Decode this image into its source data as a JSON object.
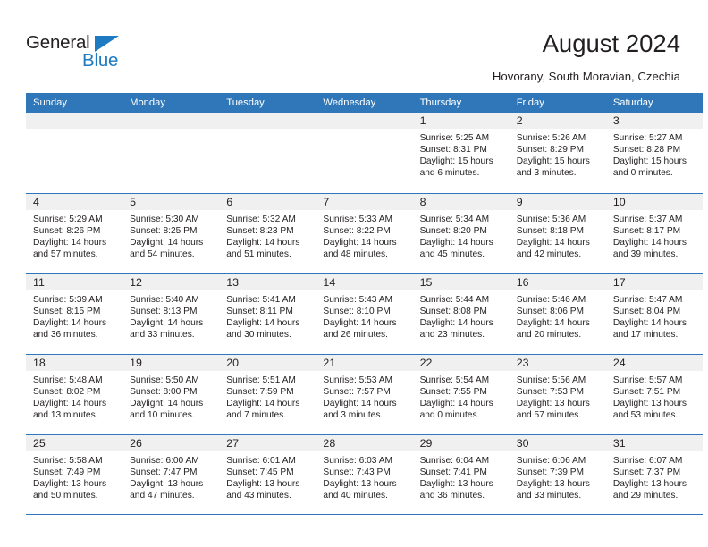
{
  "brand": {
    "name_top": "General",
    "name_bottom": "Blue",
    "triangle_color": "#1f7bc1"
  },
  "header": {
    "title": "August 2024",
    "subtitle": "Hovorany, South Moravian, Czechia"
  },
  "theme": {
    "header_bg": "#2f77b8",
    "daynum_bg": "#f0f0f0",
    "text": "#231f20",
    "grid_line": "#2f77b8"
  },
  "calendar": {
    "weekday_headers": [
      "Sunday",
      "Monday",
      "Tuesday",
      "Wednesday",
      "Thursday",
      "Friday",
      "Saturday"
    ],
    "weeks": [
      [
        {
          "empty": true
        },
        {
          "empty": true
        },
        {
          "empty": true
        },
        {
          "empty": true
        },
        {
          "day": "1",
          "sunrise": "Sunrise: 5:25 AM",
          "sunset": "Sunset: 8:31 PM",
          "daylight1": "Daylight: 15 hours",
          "daylight2": "and 6 minutes."
        },
        {
          "day": "2",
          "sunrise": "Sunrise: 5:26 AM",
          "sunset": "Sunset: 8:29 PM",
          "daylight1": "Daylight: 15 hours",
          "daylight2": "and 3 minutes."
        },
        {
          "day": "3",
          "sunrise": "Sunrise: 5:27 AM",
          "sunset": "Sunset: 8:28 PM",
          "daylight1": "Daylight: 15 hours",
          "daylight2": "and 0 minutes."
        }
      ],
      [
        {
          "day": "4",
          "sunrise": "Sunrise: 5:29 AM",
          "sunset": "Sunset: 8:26 PM",
          "daylight1": "Daylight: 14 hours",
          "daylight2": "and 57 minutes."
        },
        {
          "day": "5",
          "sunrise": "Sunrise: 5:30 AM",
          "sunset": "Sunset: 8:25 PM",
          "daylight1": "Daylight: 14 hours",
          "daylight2": "and 54 minutes."
        },
        {
          "day": "6",
          "sunrise": "Sunrise: 5:32 AM",
          "sunset": "Sunset: 8:23 PM",
          "daylight1": "Daylight: 14 hours",
          "daylight2": "and 51 minutes."
        },
        {
          "day": "7",
          "sunrise": "Sunrise: 5:33 AM",
          "sunset": "Sunset: 8:22 PM",
          "daylight1": "Daylight: 14 hours",
          "daylight2": "and 48 minutes."
        },
        {
          "day": "8",
          "sunrise": "Sunrise: 5:34 AM",
          "sunset": "Sunset: 8:20 PM",
          "daylight1": "Daylight: 14 hours",
          "daylight2": "and 45 minutes."
        },
        {
          "day": "9",
          "sunrise": "Sunrise: 5:36 AM",
          "sunset": "Sunset: 8:18 PM",
          "daylight1": "Daylight: 14 hours",
          "daylight2": "and 42 minutes."
        },
        {
          "day": "10",
          "sunrise": "Sunrise: 5:37 AM",
          "sunset": "Sunset: 8:17 PM",
          "daylight1": "Daylight: 14 hours",
          "daylight2": "and 39 minutes."
        }
      ],
      [
        {
          "day": "11",
          "sunrise": "Sunrise: 5:39 AM",
          "sunset": "Sunset: 8:15 PM",
          "daylight1": "Daylight: 14 hours",
          "daylight2": "and 36 minutes."
        },
        {
          "day": "12",
          "sunrise": "Sunrise: 5:40 AM",
          "sunset": "Sunset: 8:13 PM",
          "daylight1": "Daylight: 14 hours",
          "daylight2": "and 33 minutes."
        },
        {
          "day": "13",
          "sunrise": "Sunrise: 5:41 AM",
          "sunset": "Sunset: 8:11 PM",
          "daylight1": "Daylight: 14 hours",
          "daylight2": "and 30 minutes."
        },
        {
          "day": "14",
          "sunrise": "Sunrise: 5:43 AM",
          "sunset": "Sunset: 8:10 PM",
          "daylight1": "Daylight: 14 hours",
          "daylight2": "and 26 minutes."
        },
        {
          "day": "15",
          "sunrise": "Sunrise: 5:44 AM",
          "sunset": "Sunset: 8:08 PM",
          "daylight1": "Daylight: 14 hours",
          "daylight2": "and 23 minutes."
        },
        {
          "day": "16",
          "sunrise": "Sunrise: 5:46 AM",
          "sunset": "Sunset: 8:06 PM",
          "daylight1": "Daylight: 14 hours",
          "daylight2": "and 20 minutes."
        },
        {
          "day": "17",
          "sunrise": "Sunrise: 5:47 AM",
          "sunset": "Sunset: 8:04 PM",
          "daylight1": "Daylight: 14 hours",
          "daylight2": "and 17 minutes."
        }
      ],
      [
        {
          "day": "18",
          "sunrise": "Sunrise: 5:48 AM",
          "sunset": "Sunset: 8:02 PM",
          "daylight1": "Daylight: 14 hours",
          "daylight2": "and 13 minutes."
        },
        {
          "day": "19",
          "sunrise": "Sunrise: 5:50 AM",
          "sunset": "Sunset: 8:00 PM",
          "daylight1": "Daylight: 14 hours",
          "daylight2": "and 10 minutes."
        },
        {
          "day": "20",
          "sunrise": "Sunrise: 5:51 AM",
          "sunset": "Sunset: 7:59 PM",
          "daylight1": "Daylight: 14 hours",
          "daylight2": "and 7 minutes."
        },
        {
          "day": "21",
          "sunrise": "Sunrise: 5:53 AM",
          "sunset": "Sunset: 7:57 PM",
          "daylight1": "Daylight: 14 hours",
          "daylight2": "and 3 minutes."
        },
        {
          "day": "22",
          "sunrise": "Sunrise: 5:54 AM",
          "sunset": "Sunset: 7:55 PM",
          "daylight1": "Daylight: 14 hours",
          "daylight2": "and 0 minutes."
        },
        {
          "day": "23",
          "sunrise": "Sunrise: 5:56 AM",
          "sunset": "Sunset: 7:53 PM",
          "daylight1": "Daylight: 13 hours",
          "daylight2": "and 57 minutes."
        },
        {
          "day": "24",
          "sunrise": "Sunrise: 5:57 AM",
          "sunset": "Sunset: 7:51 PM",
          "daylight1": "Daylight: 13 hours",
          "daylight2": "and 53 minutes."
        }
      ],
      [
        {
          "day": "25",
          "sunrise": "Sunrise: 5:58 AM",
          "sunset": "Sunset: 7:49 PM",
          "daylight1": "Daylight: 13 hours",
          "daylight2": "and 50 minutes."
        },
        {
          "day": "26",
          "sunrise": "Sunrise: 6:00 AM",
          "sunset": "Sunset: 7:47 PM",
          "daylight1": "Daylight: 13 hours",
          "daylight2": "and 47 minutes."
        },
        {
          "day": "27",
          "sunrise": "Sunrise: 6:01 AM",
          "sunset": "Sunset: 7:45 PM",
          "daylight1": "Daylight: 13 hours",
          "daylight2": "and 43 minutes."
        },
        {
          "day": "28",
          "sunrise": "Sunrise: 6:03 AM",
          "sunset": "Sunset: 7:43 PM",
          "daylight1": "Daylight: 13 hours",
          "daylight2": "and 40 minutes."
        },
        {
          "day": "29",
          "sunrise": "Sunrise: 6:04 AM",
          "sunset": "Sunset: 7:41 PM",
          "daylight1": "Daylight: 13 hours",
          "daylight2": "and 36 minutes."
        },
        {
          "day": "30",
          "sunrise": "Sunrise: 6:06 AM",
          "sunset": "Sunset: 7:39 PM",
          "daylight1": "Daylight: 13 hours",
          "daylight2": "and 33 minutes."
        },
        {
          "day": "31",
          "sunrise": "Sunrise: 6:07 AM",
          "sunset": "Sunset: 7:37 PM",
          "daylight1": "Daylight: 13 hours",
          "daylight2": "and 29 minutes."
        }
      ]
    ]
  }
}
